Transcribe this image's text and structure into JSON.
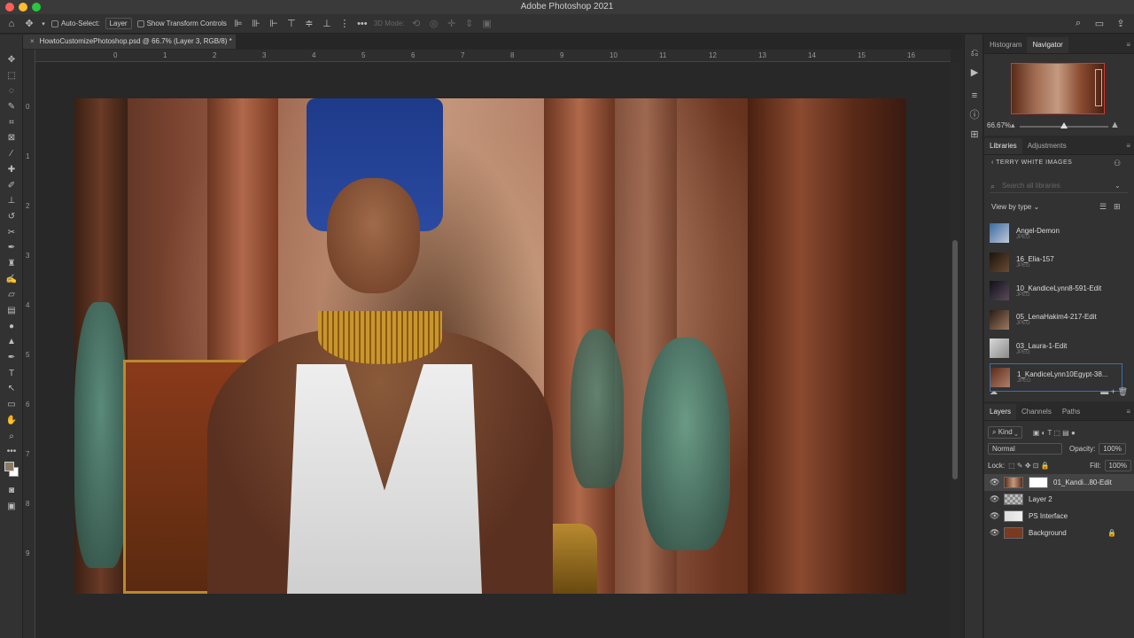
{
  "app": {
    "title": "Adobe Photoshop 2021",
    "traffic_colors": [
      "#ff5f57",
      "#febc2e",
      "#28c840"
    ]
  },
  "options_bar": {
    "auto_select_label": "Auto-Select:",
    "auto_select_value": "Layer",
    "transform_label": "Show Transform Controls",
    "mode_label": "3D Mode:"
  },
  "document": {
    "tab_label": "HowtoCustomizePhotoshop.psd @ 66.7% (Layer 3, RGB/8) *"
  },
  "rulers": {
    "h_ticks": [
      "0",
      "1",
      "2",
      "3",
      "4",
      "5",
      "6",
      "7",
      "8",
      "9",
      "10",
      "11",
      "12",
      "13",
      "14",
      "15",
      "16"
    ],
    "v_ticks": [
      "0",
      "1",
      "2",
      "3",
      "4",
      "5",
      "6",
      "7",
      "8",
      "9"
    ]
  },
  "navigator": {
    "tabs": [
      "Histogram",
      "Navigator"
    ],
    "zoom": "66.67%"
  },
  "libraries": {
    "tabs": [
      "Libraries",
      "Adjustments"
    ],
    "library_name": "TERRY WHITE IMAGES",
    "search_placeholder": "Search all libraries",
    "view_by": "View by type",
    "items": [
      {
        "name": "Angel-Demon",
        "type": "JPEG"
      },
      {
        "name": "16_Elia-157",
        "type": "JPEG"
      },
      {
        "name": "10_KandiceLynn8-591-Edit",
        "type": "JPEG"
      },
      {
        "name": "05_LenaHakim4-217-Edit",
        "type": "JPEG"
      },
      {
        "name": "03_Laura-1-Edit",
        "type": "JPEG"
      },
      {
        "name": "1_KandiceLynn10Egypt-38...",
        "type": "JPEG"
      }
    ]
  },
  "layers": {
    "tabs": [
      "Layers",
      "Channels",
      "Paths"
    ],
    "filter": "Kind",
    "blend_mode": "Normal",
    "opacity_label": "Opacity:",
    "opacity_value": "100%",
    "lock_label": "Lock:",
    "fill_label": "Fill:",
    "fill_value": "100%",
    "items": [
      {
        "name": "01_Kandi...80-Edit"
      },
      {
        "name": "Layer 2"
      },
      {
        "name": "PS Interface"
      },
      {
        "name": "Background"
      }
    ]
  }
}
